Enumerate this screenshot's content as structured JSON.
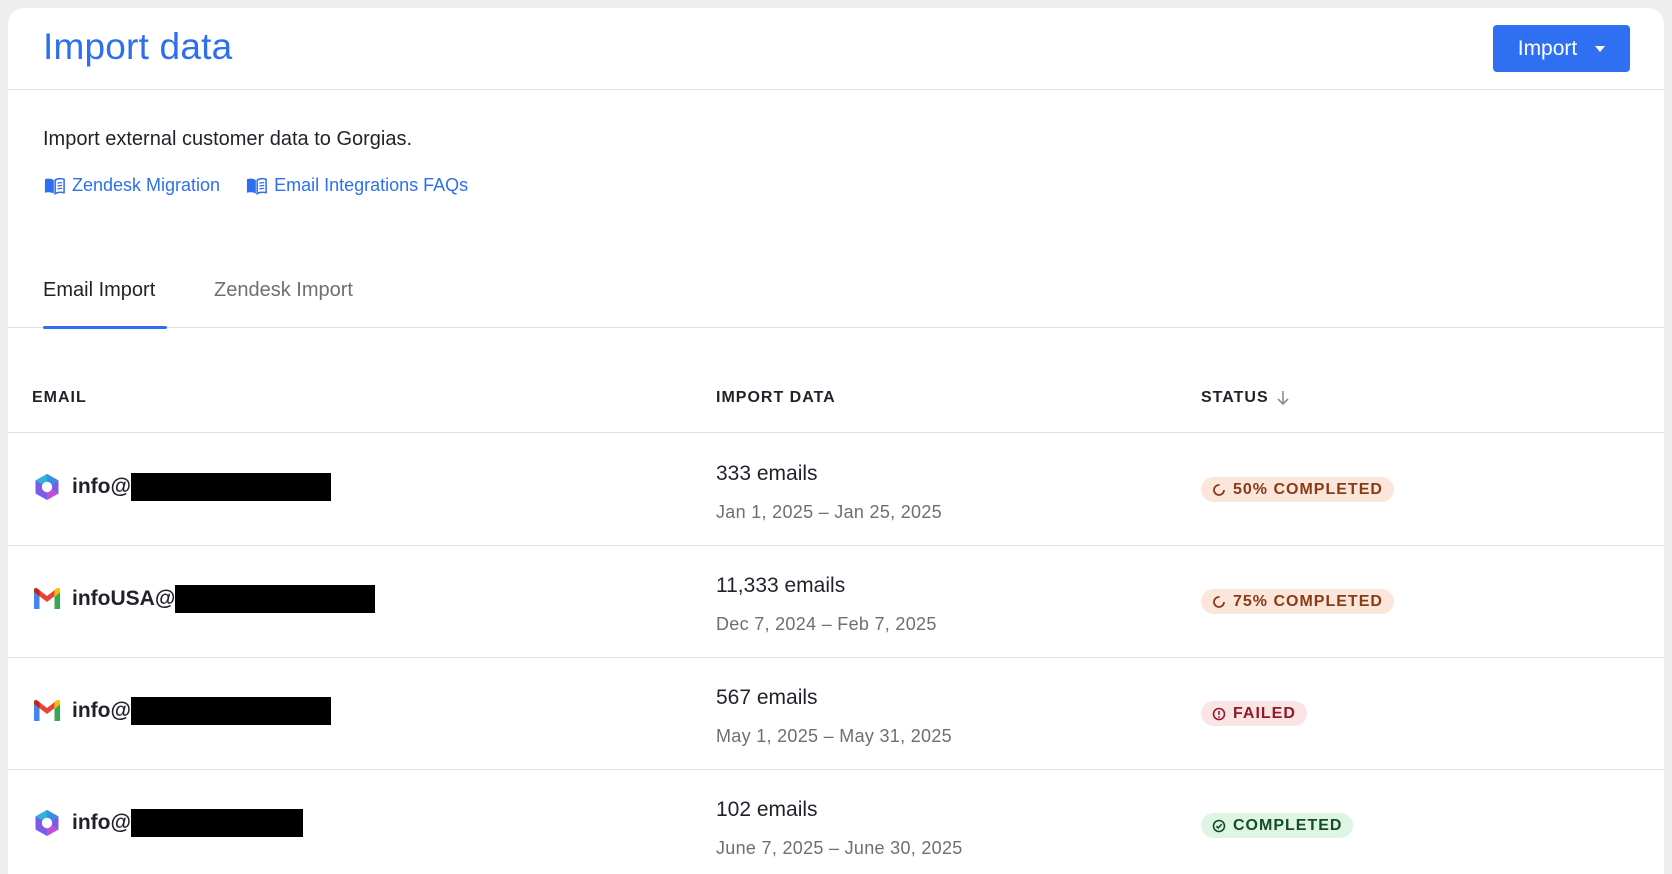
{
  "header": {
    "title": "Import data",
    "import_label": "Import"
  },
  "intro": {
    "description": "Import external customer data to Gorgias.",
    "links": [
      {
        "label": "Zendesk Migration",
        "icon": "book-open-icon"
      },
      {
        "label": "Email Integrations FAQs",
        "icon": "book-open-icon"
      }
    ]
  },
  "tabs": [
    {
      "label": "Email Import",
      "active": true
    },
    {
      "label": "Zendesk Import",
      "active": false
    }
  ],
  "table": {
    "columns": [
      "EMAIL",
      "IMPORT DATA",
      "STATUS"
    ],
    "rows": [
      {
        "provider": "microsoft-365",
        "email": "info@",
        "count": "333 emails",
        "range": "Jan 1, 2025 – Jan 25, 2025",
        "status": "50% COMPLETED",
        "status_type": "progress",
        "progress_pct": 50
      },
      {
        "provider": "gmail",
        "email": "infoUSA@",
        "count": "11,333 emails",
        "range": "Dec 7, 2024 – Feb 7, 2025",
        "status": "75% COMPLETED",
        "status_type": "progress",
        "progress_pct": 75
      },
      {
        "provider": "gmail",
        "email": "info@",
        "count": "567 emails",
        "range": "May 1, 2025 – May 31, 2025",
        "status": "FAILED",
        "status_type": "failed"
      },
      {
        "provider": "microsoft-365",
        "email": "info@",
        "count": "102 emails",
        "range": "June 7, 2025 – June 30, 2025",
        "status": "COMPLETED",
        "status_type": "completed"
      }
    ]
  },
  "colors": {
    "accent": "#2e6ff0",
    "progress_bg": "#fbe6dc",
    "failed_bg": "#fbe4e6",
    "completed_bg": "#dff5e4"
  }
}
